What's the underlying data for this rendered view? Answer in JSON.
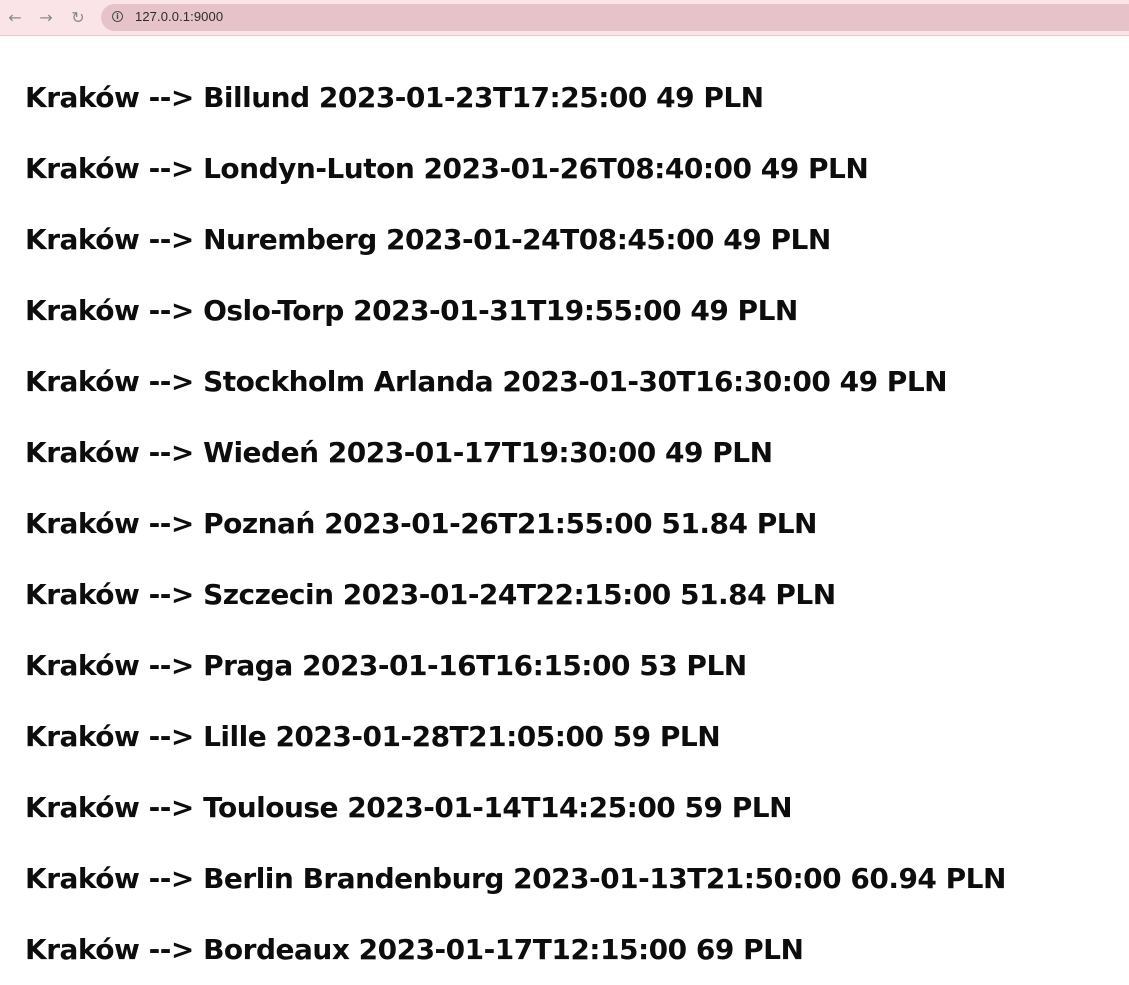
{
  "browser": {
    "back_icon": "arrow-left-icon",
    "forward_icon": "arrow-right-icon",
    "reload_icon": "reload-icon",
    "site_info_icon": "info-icon",
    "url": "127.0.0.1:9000"
  },
  "flights": [
    "Kraków --> Billund 2023-01-23T17:25:00 49 PLN",
    "Kraków --> Londyn-Luton 2023-01-26T08:40:00 49 PLN",
    "Kraków --> Nuremberg 2023-01-24T08:45:00 49 PLN",
    "Kraków --> Oslo-Torp 2023-01-31T19:55:00 49 PLN",
    "Kraków --> Stockholm Arlanda 2023-01-30T16:30:00 49 PLN",
    "Kraków --> Wiedeń 2023-01-17T19:30:00 49 PLN",
    "Kraków --> Poznań 2023-01-26T21:55:00 51.84 PLN",
    "Kraków --> Szczecin 2023-01-24T22:15:00 51.84 PLN",
    "Kraków --> Praga 2023-01-16T16:15:00 53 PLN",
    "Kraków --> Lille 2023-01-28T21:05:00 59 PLN",
    "Kraków --> Toulouse 2023-01-14T14:25:00 59 PLN",
    "Kraków --> Berlin Brandenburg 2023-01-13T21:50:00 60.94 PLN",
    "Kraków --> Bordeaux 2023-01-17T12:15:00 69 PLN"
  ]
}
